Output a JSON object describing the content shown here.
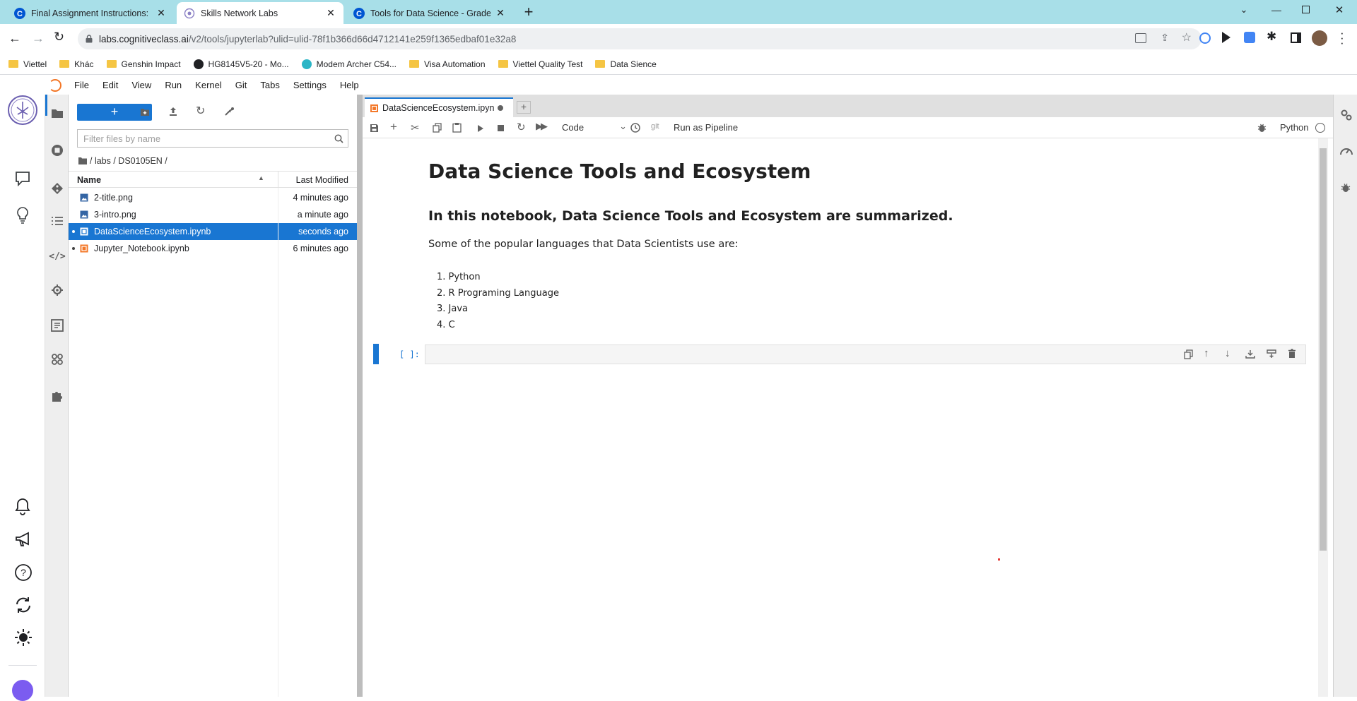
{
  "browser": {
    "tabs": [
      {
        "title": "Final Assignment Instructions: Cr",
        "active": false
      },
      {
        "title": "Skills Network Labs",
        "active": true
      },
      {
        "title": "Tools for Data Science - Grades |",
        "active": false
      }
    ],
    "url_host": "labs.cognitiveclass.ai",
    "url_path": "/v2/tools/jupyterlab?ulid=ulid-78f1b366d66d4712141e259f1365edbaf01e32a8",
    "bookmarks": [
      "Viettel",
      "Khác",
      "Genshin Impact",
      "HG8145V5-20 - Mo...",
      "Modem Archer C54...",
      "Visa Automation",
      "Viettel Quality Test",
      "Data Sience"
    ]
  },
  "menu": [
    "File",
    "Edit",
    "View",
    "Run",
    "Kernel",
    "Git",
    "Tabs",
    "Settings",
    "Help"
  ],
  "file_browser": {
    "new_button": "+",
    "filter_placeholder": "Filter files by name",
    "breadcrumb": "/ labs / DS0105EN /",
    "col_name": "Name",
    "col_modified": "Last Modified",
    "files": [
      {
        "name": "2-title.png",
        "modified": "4 minutes ago",
        "type": "image",
        "selected": false,
        "running": false
      },
      {
        "name": "3-intro.png",
        "modified": "a minute ago",
        "type": "image",
        "selected": false,
        "running": false
      },
      {
        "name": "DataScienceEcosystem.ipynb",
        "modified": "seconds ago",
        "type": "notebook",
        "selected": true,
        "running": true
      },
      {
        "name": "Jupyter_Notebook.ipynb",
        "modified": "6 minutes ago",
        "type": "notebook",
        "selected": false,
        "running": true
      }
    ]
  },
  "notebook": {
    "tab_title": "DataScienceEcosystem.ipyn",
    "cell_type": "Code",
    "git_label": "git",
    "pipeline_label": "Run as Pipeline",
    "kernel_name": "Python",
    "h1": "Data Science Tools and Ecosystem",
    "h2": "In this notebook, Data Science Tools and Ecosystem are summarized.",
    "paragraph": "Some of the popular languages that Data Scientists use are:",
    "languages": [
      "Python",
      "R Programing Language",
      "Java",
      "C"
    ],
    "prompt": "[ ]:"
  },
  "colors": {
    "accent": "#1976d2",
    "tabbar": "#a8dfe8",
    "notebook_icon": "#f37626"
  }
}
